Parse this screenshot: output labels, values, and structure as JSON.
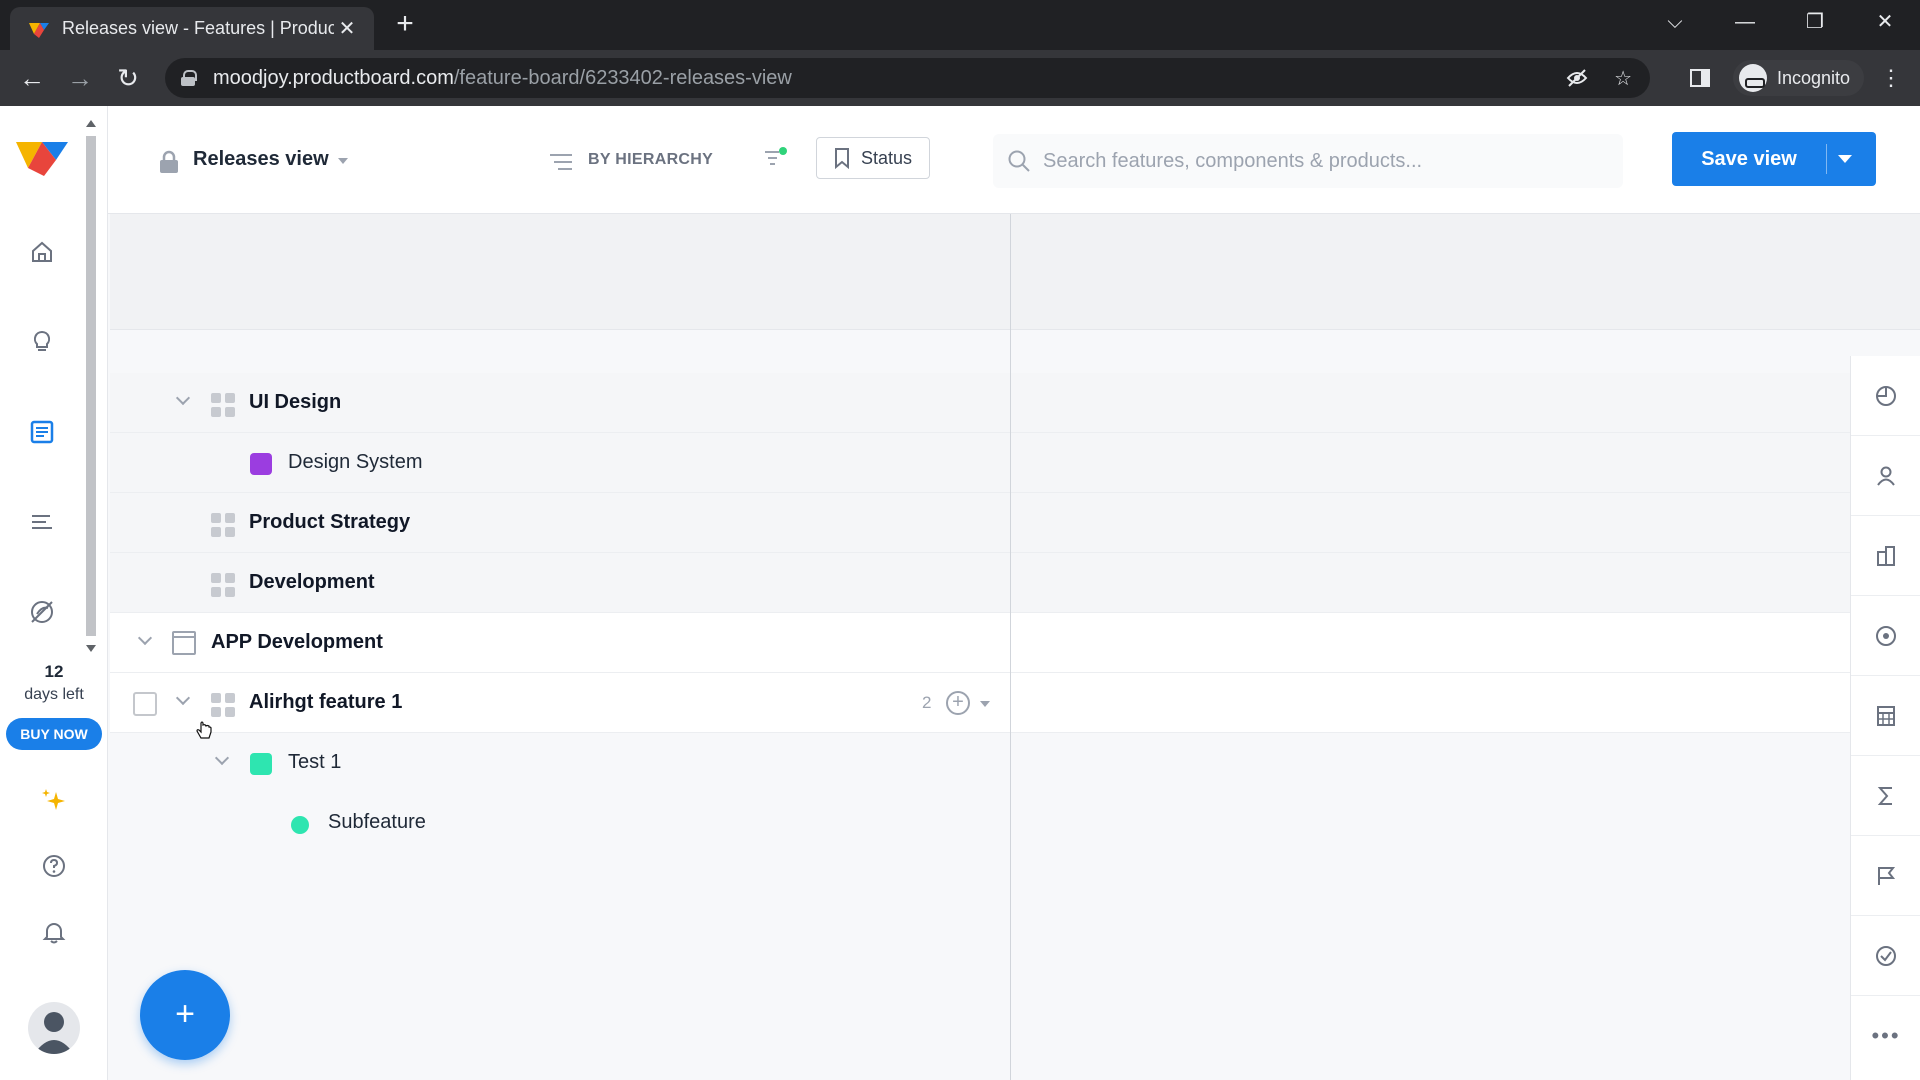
{
  "browser": {
    "tab_title": "Releases view - Features | Produc",
    "url_host": "moodjoy.productboard.com",
    "url_path": "/feature-board/6233402-releases-view",
    "profile_label": "Incognito"
  },
  "header": {
    "view_title": "Releases view",
    "grouping_label": "BY HIERARCHY",
    "status_button": "Status",
    "search_placeholder": "Search features, components & products...",
    "save_view": "Save view"
  },
  "leftnav": {
    "days_count": "12",
    "days_text": "days left",
    "buy_now": "BUY NOW"
  },
  "tree": [
    {
      "label": "UI Design",
      "kind": "component",
      "bold": true
    },
    {
      "label": "Design System",
      "kind": "feature",
      "color": "#9b3de0"
    },
    {
      "label": "Product Strategy",
      "kind": "component",
      "bold": true
    },
    {
      "label": "Development",
      "kind": "component",
      "bold": true
    },
    {
      "label": "APP Development",
      "kind": "product",
      "bold": true
    },
    {
      "label": "Alirhgt feature 1",
      "kind": "component",
      "bold": true,
      "count": "2"
    },
    {
      "label": "Test 1",
      "kind": "feature",
      "color": "#2ee5b0"
    },
    {
      "label": "Subfeature",
      "kind": "subfeature",
      "color": "#2ee5b0"
    }
  ],
  "colors": {
    "accent": "#1a7fe8",
    "chrome_dark": "#202124"
  }
}
